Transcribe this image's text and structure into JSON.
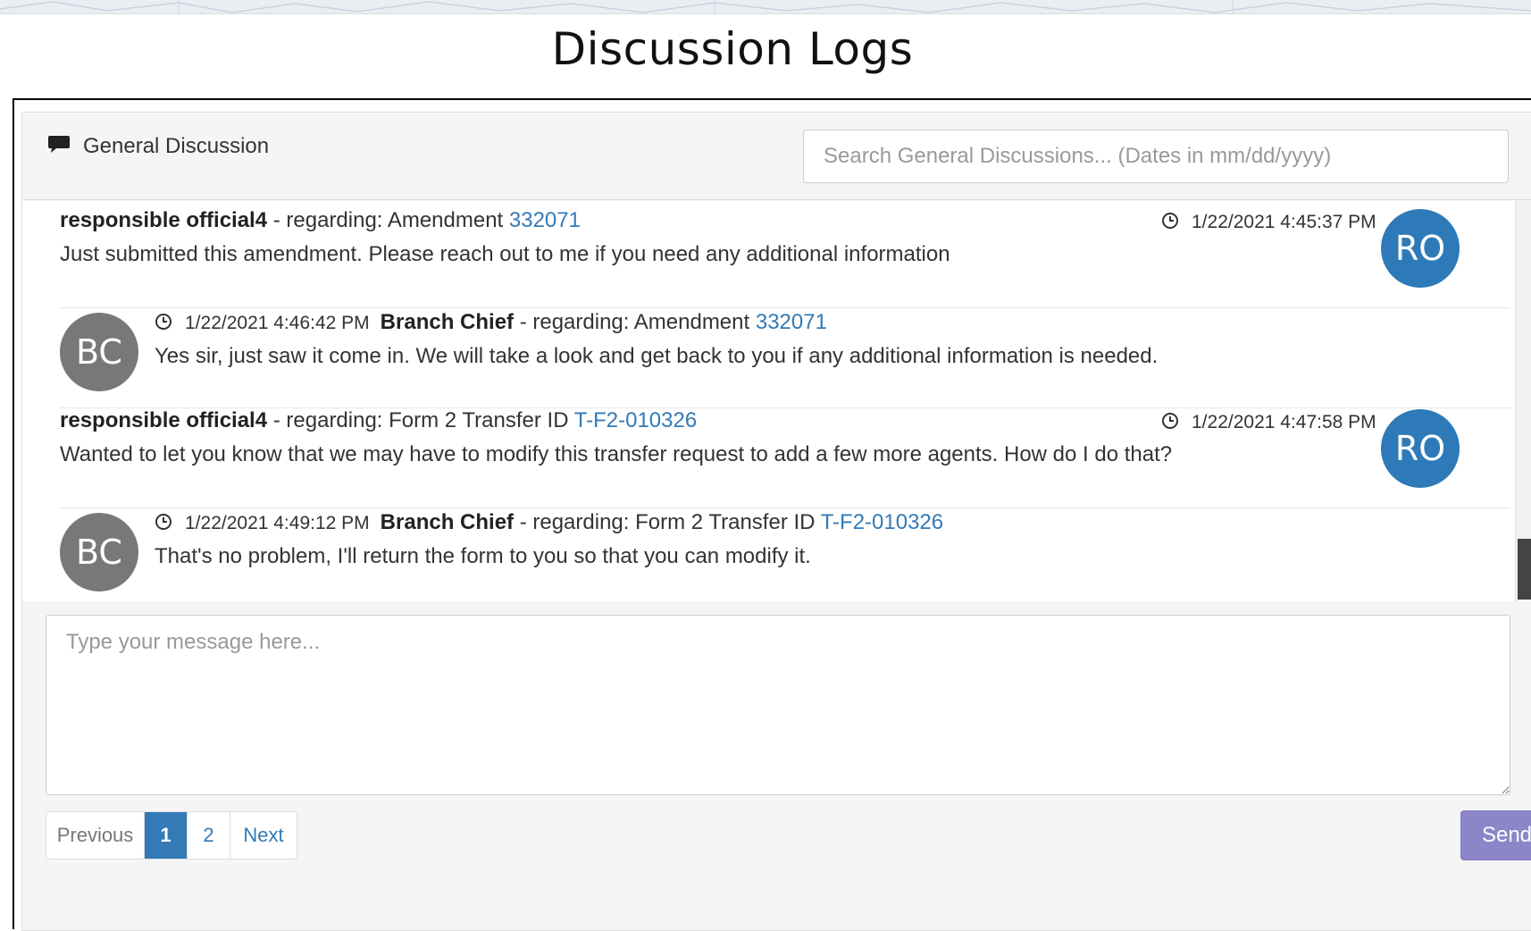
{
  "page": {
    "title": "Discussion Logs"
  },
  "panel": {
    "title": "General Discussion",
    "icon": "comment-icon",
    "search": {
      "placeholder": "Search General Discussions... (Dates in mm/dd/yyyy)",
      "value": ""
    }
  },
  "messages": [
    {
      "author": "responsible official4",
      "regarding_prefix": " - regarding: Amendment ",
      "regarding_link": "332071",
      "timestamp": "1/22/2021 4:45:37 PM",
      "text": "Just submitted this amendment. Please reach out to me if you need any additional information",
      "initials": "RO",
      "side": "right"
    },
    {
      "author": "Branch Chief",
      "regarding_prefix": " - regarding: Amendment ",
      "regarding_link": "332071",
      "timestamp": "1/22/2021 4:46:42 PM",
      "text": "Yes sir, just saw it come in. We will take a look and get back to you if any additional information is needed.",
      "initials": "BC",
      "side": "left"
    },
    {
      "author": "responsible official4",
      "regarding_prefix": " - regarding: Form 2 Transfer ID ",
      "regarding_link": "T-F2-010326",
      "timestamp": "1/22/2021 4:47:58 PM",
      "text": "Wanted to let you know that we may have to modify this transfer request to add a few more agents. How do I do that?",
      "initials": "RO",
      "side": "right"
    },
    {
      "author": "Branch Chief",
      "regarding_prefix": " - regarding: Form 2 Transfer ID ",
      "regarding_link": "T-F2-010326",
      "timestamp": "1/22/2021 4:49:12 PM",
      "text": "That's no problem, I'll return the form to you so that you can modify it.",
      "initials": "BC",
      "side": "left"
    }
  ],
  "composer": {
    "placeholder": "Type your message here...",
    "value": ""
  },
  "pagination": {
    "previous": "Previous",
    "pages": [
      "1",
      "2"
    ],
    "active_page": "1",
    "next": "Next"
  },
  "send_label": "Send",
  "colors": {
    "link": "#337ab7",
    "ro_avatar": "#2e7ab8",
    "bc_avatar": "#787878",
    "send_button": "#8c86c9",
    "active_page": "#337ab7"
  }
}
